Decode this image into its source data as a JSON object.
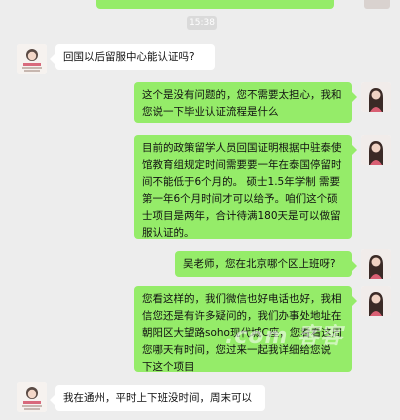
{
  "timestamp": "15:38",
  "messages": [
    {
      "side": "left",
      "text": "回国以后留服中心能认证吗?"
    },
    {
      "side": "right",
      "text": "这个是没有问题的，您不需要太担心，我和\n您说一下毕业认证流程是什么"
    },
    {
      "side": "right",
      "text": "目前的政策留学人员回国证明根据中驻泰使\n馆教育组规定时间需要要一年在泰国停留时\n间不能低于6个月的。  硕士1.5年学制  需要\n第一年6个月时间才可以给予。咱们这个硕\n士项目是两年，合计待满180天是可以做留\n服认证的。"
    },
    {
      "side": "right",
      "text": "吴老师，您在北京哪个区上班呀?"
    },
    {
      "side": "right",
      "text": "您看这样的，我们微信也好电话也好，我相\n信您还是有许多疑问的，我们办事处地址在\n朝阳区大望路soho现代城C座，您看看这周\n您哪天有时间，您过来一起我详细给您说\n下这个项目"
    },
    {
      "side": "left",
      "text": "我在通州，平时上下班没时间，周末可以"
    }
  ],
  "watermark": ".com 客客"
}
